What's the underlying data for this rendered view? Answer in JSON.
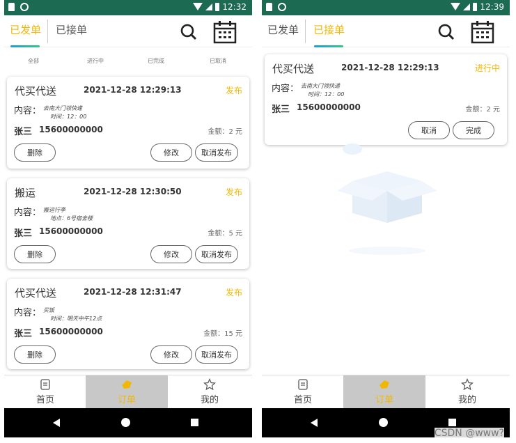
{
  "status_left": {
    "time": "12:32"
  },
  "status_right": {
    "time": "12:39"
  },
  "tabs": {
    "sent": "已发单",
    "received": "已接单"
  },
  "filters": [
    "全部",
    "进行中",
    "已完成",
    "已取消"
  ],
  "left_cards": [
    {
      "title": "代买代送",
      "time": "2021-12-28 12:29:13",
      "status": "发布",
      "content_label": "内容：",
      "line1": "去南大门领快递",
      "line2": "时间：12：00",
      "name": "张三",
      "phone": "15600000000",
      "amount": "金额：2 元",
      "btn_delete": "删除",
      "btn_edit": "修改",
      "btn_cancel": "取消发布"
    },
    {
      "title": "搬运",
      "time": "2021-12-28 12:30:50",
      "status": "发布",
      "content_label": "内容：",
      "line1": "搬运行李",
      "line2": "地点：6号宿舍楼",
      "name": "张三",
      "phone": "15600000000",
      "amount": "金额：5 元",
      "btn_delete": "删除",
      "btn_edit": "修改",
      "btn_cancel": "取消发布"
    },
    {
      "title": "代买代送",
      "time": "2021-12-28 12:31:47",
      "status": "发布",
      "content_label": "内容：",
      "line1": "买饭",
      "line2": "时间：明天中午12点",
      "name": "张三",
      "phone": "15600000000",
      "amount": "金额：15 元",
      "btn_delete": "删除",
      "btn_edit": "修改",
      "btn_cancel": "取消发布"
    }
  ],
  "right_card": {
    "title": "代买代送",
    "time": "2021-12-28 12:29:13",
    "status": "进行中",
    "content_label": "内容：",
    "line1": "去南大门领快递",
    "line2": "时间：12：00",
    "name": "张三",
    "phone": "15600000000",
    "amount": "金额：2 元",
    "btn_cancel": "取消",
    "btn_done": "完成"
  },
  "nav": {
    "home": "首页",
    "orders": "订单",
    "mine": "我的"
  },
  "watermark": "CSDN @www?",
  "colors": {
    "accent": "#f2b705",
    "statusbar": "#1c6a51"
  }
}
